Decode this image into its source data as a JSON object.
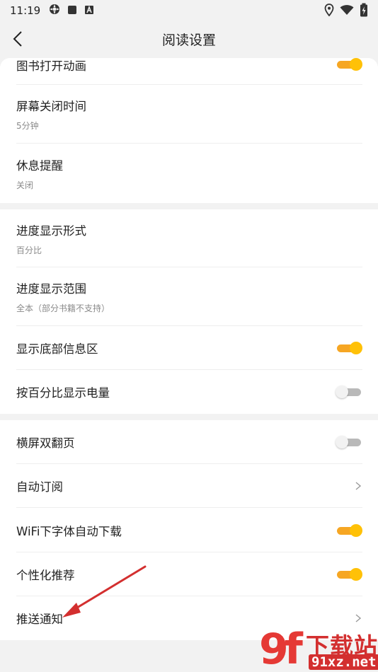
{
  "status_bar": {
    "time": "11:19",
    "left_icons": [
      "settings-app-icon",
      "square-app-icon",
      "letter-a-app-icon"
    ],
    "right_icons": [
      "location-icon",
      "wifi-icon",
      "battery-charging-icon"
    ]
  },
  "header": {
    "title": "阅读设置"
  },
  "sections": [
    {
      "rows": [
        {
          "label": "图书打开动画",
          "sub": "",
          "control": "toggle",
          "on": true
        },
        {
          "label": "屏幕关闭时间",
          "sub": "5分钟",
          "control": "none"
        },
        {
          "label": "休息提醒",
          "sub": "关闭",
          "control": "none"
        }
      ]
    },
    {
      "rows": [
        {
          "label": "进度显示形式",
          "sub": "百分比",
          "control": "none"
        },
        {
          "label": "进度显示范围",
          "sub": "全本（部分书籍不支持）",
          "control": "none"
        },
        {
          "label": "显示底部信息区",
          "sub": "",
          "control": "toggle",
          "on": true
        },
        {
          "label": "按百分比显示电量",
          "sub": "",
          "control": "toggle",
          "on": false
        }
      ]
    },
    {
      "rows": [
        {
          "label": "横屏双翻页",
          "sub": "",
          "control": "toggle",
          "on": false
        },
        {
          "label": "自动订阅",
          "sub": "",
          "control": "chevron"
        },
        {
          "label": "WiFi下字体自动下载",
          "sub": "",
          "control": "toggle",
          "on": true
        },
        {
          "label": "个性化推荐",
          "sub": "",
          "control": "toggle",
          "on": true
        },
        {
          "label": "推送通知",
          "sub": "",
          "control": "chevron"
        }
      ]
    }
  ],
  "colors": {
    "accent": "#f6a623",
    "knob_on": "#ffc107",
    "annotation_arrow": "#d32f2f",
    "watermark": "#d32f2f"
  },
  "watermark": {
    "logo_glyph": "9f",
    "title": "下载站",
    "domain": "91xz.net"
  }
}
